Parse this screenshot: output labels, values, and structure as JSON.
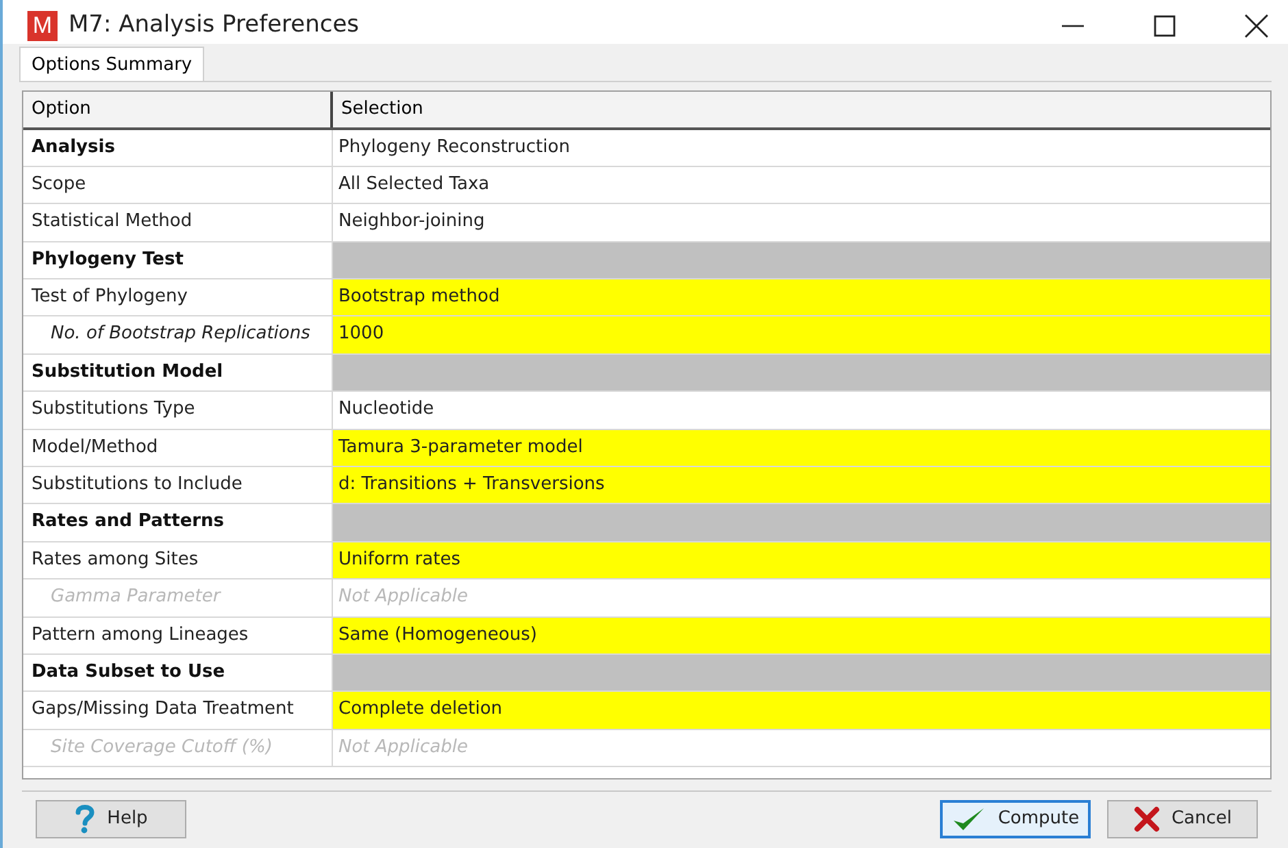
{
  "window": {
    "title": "M7: Analysis Preferences",
    "icon_letter": "M"
  },
  "tabs": [
    {
      "label": "Options Summary",
      "selected": true
    }
  ],
  "table": {
    "columns": [
      "Option",
      "Selection"
    ],
    "rows": [
      {
        "kind": "header",
        "option": "Analysis",
        "selection": "Phylogeny Reconstruction"
      },
      {
        "kind": "option",
        "option": "Scope",
        "selection": "All Selected Taxa",
        "highlighted": false,
        "disabled": false
      },
      {
        "kind": "option",
        "option": "Statistical Method",
        "selection": "Neighbor-joining",
        "highlighted": false,
        "disabled": false
      },
      {
        "kind": "header",
        "option": "Phylogeny Test"
      },
      {
        "kind": "option",
        "option": "Test of Phylogeny",
        "selection": "Bootstrap method",
        "highlighted": true,
        "disabled": false
      },
      {
        "kind": "sub",
        "option": "No. of Bootstrap Replications",
        "selection": "1000",
        "highlighted": true,
        "disabled": false
      },
      {
        "kind": "header",
        "option": "Substitution Model"
      },
      {
        "kind": "option",
        "option": "Substitutions Type",
        "selection": "Nucleotide",
        "highlighted": false,
        "disabled": false
      },
      {
        "kind": "option",
        "option": "Model/Method",
        "selection": "Tamura 3-parameter model",
        "highlighted": true,
        "disabled": false
      },
      {
        "kind": "option",
        "option": "Substitutions to Include",
        "selection": "d: Transitions + Transversions",
        "highlighted": true,
        "disabled": false
      },
      {
        "kind": "header",
        "option": "Rates and Patterns"
      },
      {
        "kind": "option",
        "option": "Rates among Sites",
        "selection": "Uniform rates",
        "highlighted": true,
        "disabled": false
      },
      {
        "kind": "sub",
        "option": "Gamma Parameter",
        "selection": "Not Applicable",
        "highlighted": false,
        "disabled": true
      },
      {
        "kind": "option",
        "option": "Pattern among Lineages",
        "selection": "Same (Homogeneous)",
        "highlighted": true,
        "disabled": false
      },
      {
        "kind": "header",
        "option": "Data Subset to Use"
      },
      {
        "kind": "option",
        "option": "Gaps/Missing Data Treatment",
        "selection": "Complete deletion",
        "highlighted": true,
        "disabled": false
      },
      {
        "kind": "sub",
        "option": "Site Coverage Cutoff (%)",
        "selection": "Not Applicable",
        "highlighted": false,
        "disabled": true
      }
    ]
  },
  "buttons": [
    {
      "kind": "help",
      "label": "Help",
      "focused": false
    },
    {
      "kind": "compute",
      "label": "Compute",
      "focused": true
    },
    {
      "kind": "cancel",
      "label": "Cancel",
      "focused": false
    }
  ]
}
